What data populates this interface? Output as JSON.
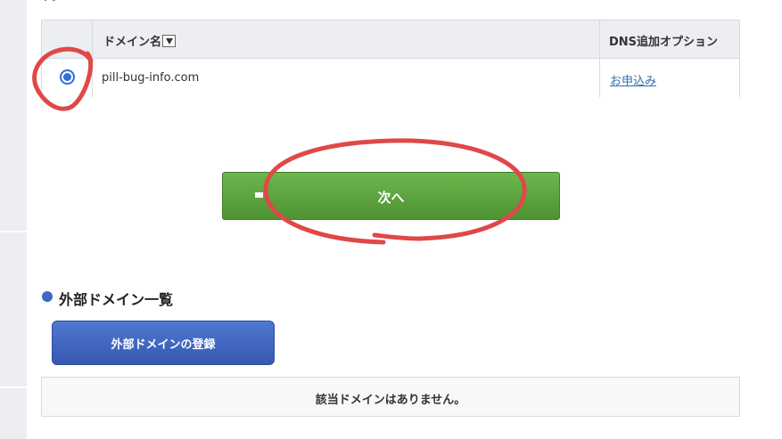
{
  "page": {
    "cutoff_text": "す。"
  },
  "domain_table": {
    "headers": {
      "domain_name": "ドメイン名",
      "dns_option": "DNS追加オプション"
    },
    "rows": [
      {
        "selected": true,
        "domain": "pill-bug-info.com",
        "dns_link": "お申込み"
      }
    ]
  },
  "next_button": {
    "label": "次へ"
  },
  "external_section": {
    "title": "外部ドメイン一覧",
    "register_button": "外部ドメインの登録",
    "empty_message": "該当ドメインはありません。"
  },
  "colors": {
    "accent_green": "#5ea640",
    "accent_blue": "#3d68c3",
    "annotation_red": "#e04848"
  },
  "icons": {
    "sort": "sort-down-icon",
    "bullet": "bullet-icon"
  }
}
